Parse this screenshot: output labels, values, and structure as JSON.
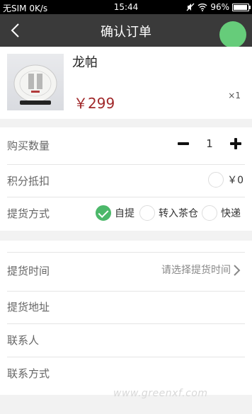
{
  "status_bar": {
    "carrier": "无SIM 0K/s",
    "time": "15:44",
    "battery": "96%",
    "battery_level": 0.96,
    "icons": [
      "mute-icon",
      "wifi-icon",
      "battery-icon"
    ]
  },
  "nav": {
    "title": "确认订单",
    "back_icon": "chevron-left-icon",
    "accent": "#66cc7a"
  },
  "product": {
    "name": "龙帕",
    "price": "￥299",
    "quantity": "×1",
    "price_color": "#a0282a"
  },
  "order": {
    "quantity_label": "购买数量",
    "quantity_value": "1",
    "points_label": "积分抵扣",
    "points_value": "￥0",
    "delivery_label": "提货方式",
    "delivery_options": [
      {
        "label": "自提",
        "checked": true
      },
      {
        "label": "转入茶仓",
        "checked": false
      },
      {
        "label": "快递",
        "checked": false
      }
    ]
  },
  "pickup": {
    "time_label": "提货时间",
    "time_placeholder": "请选择提货时间",
    "address_label": "提货地址",
    "contact_label": "联系人",
    "phone_label": "联系方式"
  },
  "watermark": "www.greenxf.com"
}
